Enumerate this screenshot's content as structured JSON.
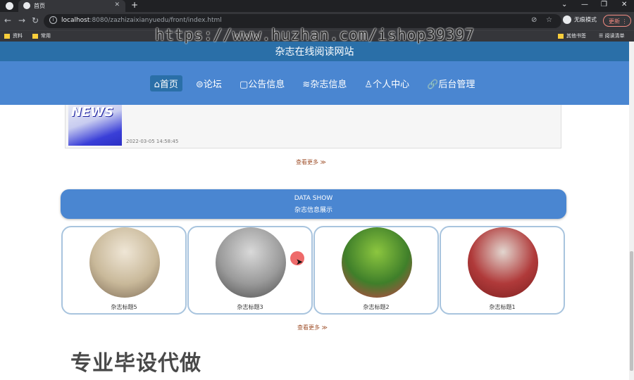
{
  "browser": {
    "tab_title": "首页",
    "tab_close": "✕",
    "new_tab": "+",
    "window_controls": [
      "⌄",
      "—",
      "❐",
      "✕"
    ],
    "url_host": "localhost",
    "url_rest": ":8080/zazhizaixianyuedu/front/index.html",
    "incognito_label": "无痕模式",
    "update_label": "更新",
    "bookmarks": [
      "资料",
      "常用"
    ],
    "bookmarks_right": [
      "其他书签",
      "阅读清单"
    ]
  },
  "watermark_url": "https://www.huzhan.com/ishop39397",
  "site": {
    "title": "杂志在线阅读网站",
    "nav": [
      {
        "icon": "⌂",
        "label": "首页"
      },
      {
        "icon": "⊜",
        "label": "论坛"
      },
      {
        "icon": "▢",
        "label": "公告信息"
      },
      {
        "icon": "≋",
        "label": "杂志信息"
      },
      {
        "icon": "♙",
        "label": "个人中心"
      },
      {
        "icon": "🔗",
        "label": "后台管理"
      }
    ]
  },
  "news": {
    "image_text": "NEWS",
    "date": "2022-03-05 14:58:45",
    "more_label": "查看更多 ≫"
  },
  "data_show": {
    "en": "DATA SHOW",
    "cn": "杂志信息展示"
  },
  "magazines": [
    {
      "title": "杂志标题5",
      "palette": [
        "#efe6d6",
        "#c9b99a",
        "#7d6a55"
      ]
    },
    {
      "title": "杂志标题3",
      "palette": [
        "#d9d9d9",
        "#9a9a9a",
        "#4a4a4a"
      ]
    },
    {
      "title": "杂志标题2",
      "palette": [
        "#8cc63f",
        "#3f7f2a",
        "#d43a4a"
      ]
    },
    {
      "title": "杂志标题1",
      "palette": [
        "#e2d6cf",
        "#b03a3a",
        "#7a1f1f"
      ]
    }
  ],
  "magazines_more_label": "查看更多 ≫",
  "watermark_pro": "专业毕设代做"
}
